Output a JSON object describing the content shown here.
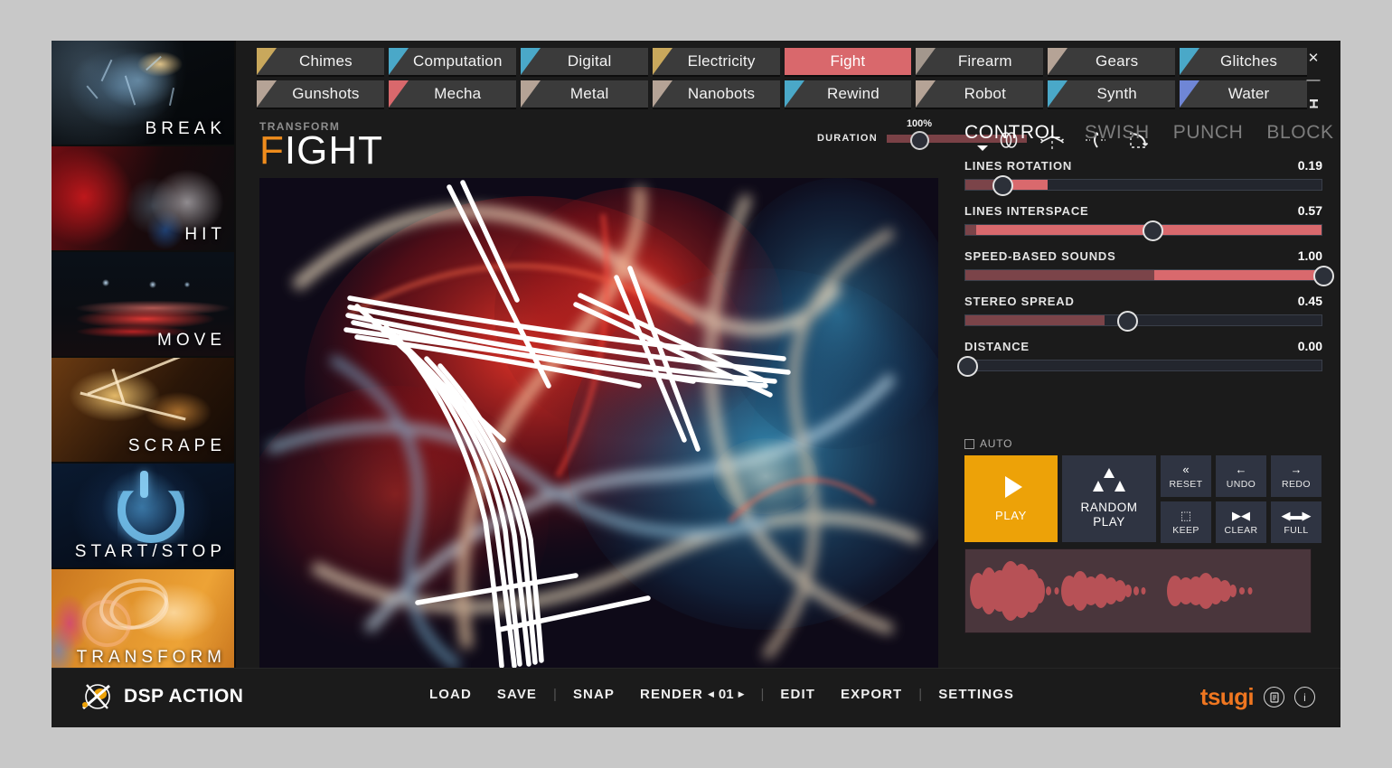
{
  "window": {
    "controls": [
      {
        "name": "close",
        "glyph": "✕"
      },
      {
        "name": "minimize",
        "glyph": "—"
      },
      {
        "name": "pin",
        "glyph": "ⸯ"
      }
    ]
  },
  "sidebar": {
    "items": [
      {
        "label": "BREAK",
        "art": "art-break",
        "active": false
      },
      {
        "label": "HIT",
        "art": "art-hit",
        "active": false
      },
      {
        "label": "MOVE",
        "art": "art-move",
        "active": false
      },
      {
        "label": "SCRAPE",
        "art": "art-scrape",
        "active": false
      },
      {
        "label": "START/STOP",
        "art": "art-start",
        "active": false
      },
      {
        "label": "TRANSFORM",
        "art": "art-transform",
        "active": true
      }
    ]
  },
  "tabs": {
    "row1": [
      {
        "label": "Chimes",
        "color": "#c9a85c",
        "active": false
      },
      {
        "label": "Computation",
        "color": "#4aa8c8",
        "active": false
      },
      {
        "label": "Digital",
        "color": "#4aa8c8",
        "active": false
      },
      {
        "label": "Electricity",
        "color": "#c9a85c",
        "active": false
      },
      {
        "label": "Fight",
        "color": "#d9686c",
        "active": true
      },
      {
        "label": "Firearm",
        "color": "#a3978d",
        "active": false
      },
      {
        "label": "Gears",
        "color": "#b5a396",
        "active": false
      },
      {
        "label": "Glitches",
        "color": "#4aa8c8",
        "active": false
      }
    ],
    "row2": [
      {
        "label": "Gunshots",
        "color": "#b5a396",
        "active": false
      },
      {
        "label": "Mecha",
        "color": "#d9686c",
        "active": false
      },
      {
        "label": "Metal",
        "color": "#b5a396",
        "active": false
      },
      {
        "label": "Nanobots",
        "color": "#b5a396",
        "active": false
      },
      {
        "label": "Rewind",
        "color": "#4aa8c8",
        "active": false
      },
      {
        "label": "Robot",
        "color": "#b5a396",
        "active": false
      },
      {
        "label": "Synth",
        "color": "#4aa8c8",
        "active": false
      },
      {
        "label": "Water",
        "color": "#6f86d6",
        "active": false
      }
    ]
  },
  "header": {
    "kicker": "TRANSFORM",
    "title_initial": "F",
    "title_rest": "IGHT",
    "duration_label": "DURATION",
    "duration_value": "100%",
    "duration_handle_pct": 22,
    "transform_icons": [
      {
        "name": "loop-icon"
      },
      {
        "name": "flip-vertical-icon"
      },
      {
        "name": "flip-horizontal-icon"
      },
      {
        "name": "rotate-icon"
      }
    ]
  },
  "panel": {
    "tabs": [
      {
        "label": "CONTROL",
        "active": true
      },
      {
        "label": "SWISH",
        "active": false
      },
      {
        "label": "PUNCH",
        "active": false
      },
      {
        "label": "BLOCK",
        "active": false
      }
    ],
    "sliders": [
      {
        "name": "LINES ROTATION",
        "value": "0.19",
        "handle_pct": 10,
        "dim_pct": 10,
        "hot_pct": 23
      },
      {
        "name": "LINES INTERSPACE",
        "value": "0.57",
        "handle_pct": 52,
        "dim_pct": 3,
        "hot_pct": 100
      },
      {
        "name": "SPEED-BASED SOUNDS",
        "value": "1.00",
        "handle_pct": 100,
        "dim_pct": 53,
        "hot_pct": 100
      },
      {
        "name": "STEREO SPREAD",
        "value": "0.45",
        "handle_pct": 45,
        "dim_pct": 39,
        "hot_pct": 39
      },
      {
        "name": "DISTANCE",
        "value": "0.00",
        "handle_pct": 0,
        "dim_pct": 0,
        "hot_pct": 0
      }
    ],
    "auto_label": "AUTO",
    "auto_checked": false,
    "play_label": "PLAY",
    "random_play_label": "RANDOM\nPLAY",
    "mini_buttons": [
      {
        "label": "RESET",
        "icon": "«"
      },
      {
        "label": "UNDO",
        "icon": "←"
      },
      {
        "label": "REDO",
        "icon": "→"
      },
      {
        "label": "KEEP",
        "icon": "⬚"
      },
      {
        "label": "CLEAR",
        "icon": "▶◀"
      },
      {
        "label": "FULL",
        "icon": "◀▬▶"
      }
    ]
  },
  "footer": {
    "logo_text": "DSP ACTION",
    "menu": [
      {
        "type": "item",
        "label": "LOAD"
      },
      {
        "type": "item",
        "label": "SAVE"
      },
      {
        "type": "sep",
        "label": "|"
      },
      {
        "type": "item",
        "label": "SNAP"
      },
      {
        "type": "render",
        "label": "RENDER",
        "number": "01"
      },
      {
        "type": "sep",
        "label": "|"
      },
      {
        "type": "item",
        "label": "EDIT"
      },
      {
        "type": "item",
        "label": "EXPORT"
      },
      {
        "type": "sep",
        "label": "|"
      },
      {
        "type": "item",
        "label": "SETTINGS"
      }
    ],
    "brand": "tsugi",
    "brand_buttons": [
      {
        "name": "document-icon",
        "glyph": "☰"
      },
      {
        "name": "info-icon",
        "glyph": "i"
      }
    ]
  },
  "colors": {
    "accent_red": "#d9686c",
    "accent_orange": "#eda208",
    "panel_bg": "#2f3442",
    "window_bg": "#1b1b1b"
  }
}
